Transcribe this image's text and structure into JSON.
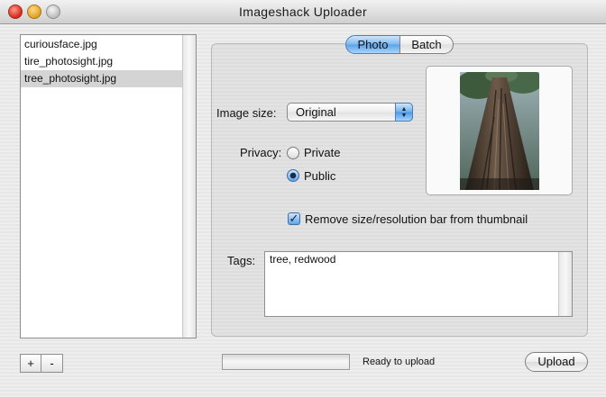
{
  "window": {
    "title": "Imageshack Uploader"
  },
  "files": [
    {
      "name": "curiousface.jpg",
      "selected": false
    },
    {
      "name": "tire_photosight.jpg",
      "selected": false
    },
    {
      "name": "tree_photosight.jpg",
      "selected": true
    }
  ],
  "list_buttons": {
    "add": "+",
    "remove": "-"
  },
  "tabs": [
    {
      "label": "Photo",
      "selected": true
    },
    {
      "label": "Batch",
      "selected": false
    }
  ],
  "photo": {
    "image_size_label": "Image size:",
    "image_size_value": "Original",
    "privacy_label": "Privacy:",
    "privacy_options": [
      {
        "label": "Private",
        "checked": false
      },
      {
        "label": "Public",
        "checked": true
      }
    ],
    "remove_bar_label": "Remove size/resolution bar from thumbnail",
    "remove_bar_checked": true,
    "tags_label": "Tags:",
    "tags_value": "tree, redwood"
  },
  "footer": {
    "progress": 0,
    "status": "Ready to upload",
    "upload_label": "Upload"
  },
  "colors": {
    "accent": "#5aa2ea",
    "selection": "#d4d4d4"
  },
  "icons": {
    "close": "close-icon",
    "minimize": "minimize-icon",
    "zoom": "zoom-icon",
    "popup": "chevron-updown-icon",
    "check": "checkmark-icon"
  }
}
